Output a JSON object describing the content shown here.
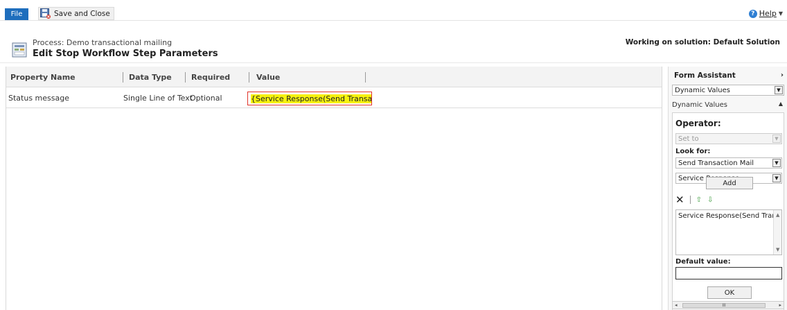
{
  "ribbon": {
    "file_label": "File",
    "save_close_label": "Save and Close",
    "help_label": "Help"
  },
  "header": {
    "process_line": "Process: Demo transactional mailing",
    "title": "Edit Stop Workflow Step Parameters",
    "solution": "Working on solution: Default Solution"
  },
  "grid": {
    "columns": [
      "Property Name",
      "Data Type",
      "Required",
      "Value"
    ],
    "rows": [
      {
        "property_name": "Status message",
        "data_type": "Single Line of Text",
        "required": "Optional",
        "value": "{Service Response(Send Transacti"
      }
    ]
  },
  "form_assistant": {
    "title": "Form Assistant",
    "mode_select": "Dynamic Values",
    "section_title": "Dynamic Values",
    "operator_label": "Operator:",
    "operator_value": "Set to",
    "look_for_label": "Look for:",
    "look_for_entity": "Send Transaction Mail",
    "look_for_field": "Service Response",
    "add_label": "Add",
    "list_items": [
      "Service Response(Send Transactio"
    ],
    "default_value_label": "Default value:",
    "default_value": "",
    "ok_label": "OK"
  },
  "colors": {
    "file_button": "#1e6ebd",
    "highlight": "#f6f20d",
    "focus_border": "#e0342a",
    "arrow_green": "#3a9a3a"
  }
}
